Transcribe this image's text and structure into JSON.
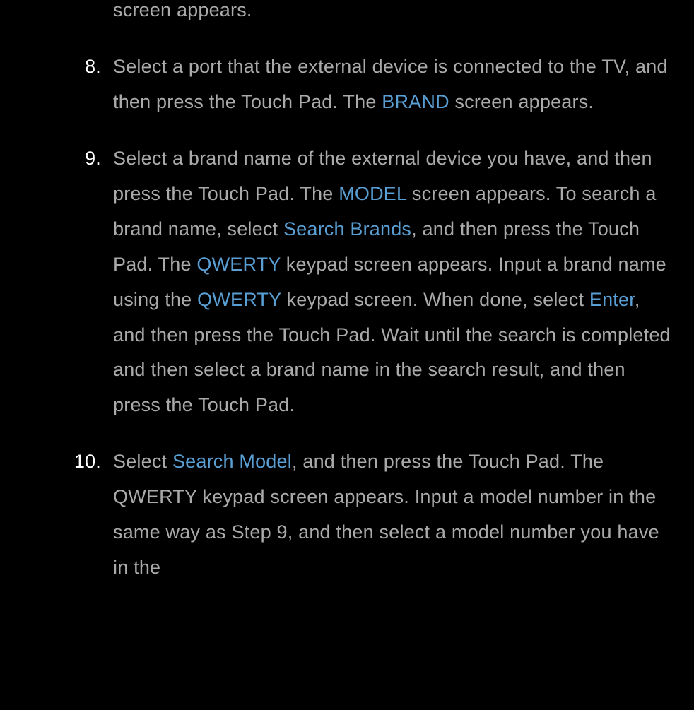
{
  "fragment_top": "screen appears.",
  "items": [
    {
      "number": "8.",
      "parts": [
        {
          "t": "Select a port that the external device is connected to the TV, and then press the Touch Pad. The ",
          "h": false
        },
        {
          "t": "BRAND",
          "h": true
        },
        {
          "t": " screen appears.",
          "h": false
        }
      ]
    },
    {
      "number": "9.",
      "parts": [
        {
          "t": "Select a brand name of the external device you have, and then press the Touch Pad. The ",
          "h": false
        },
        {
          "t": "MODEL",
          "h": true
        },
        {
          "t": " screen appears. To search a brand name, select ",
          "h": false
        },
        {
          "t": "Search Brands",
          "h": true
        },
        {
          "t": ", and then press the Touch Pad. The ",
          "h": false
        },
        {
          "t": "QWERTY",
          "h": true
        },
        {
          "t": " keypad screen appears. Input a brand name using the ",
          "h": false
        },
        {
          "t": "QWERTY",
          "h": true
        },
        {
          "t": " keypad screen. When done, select ",
          "h": false
        },
        {
          "t": "Enter",
          "h": true
        },
        {
          "t": ", and then press the Touch Pad. Wait until the search is completed and then select a brand name in the search result, and then press the Touch Pad.",
          "h": false
        }
      ]
    },
    {
      "number": "10.",
      "parts": [
        {
          "t": "Select ",
          "h": false
        },
        {
          "t": "Search Model",
          "h": true
        },
        {
          "t": ", and then press the Touch Pad. The QWERTY keypad screen appears. Input a model number in the same way as Step 9, and then select a model number you have in the",
          "h": false
        }
      ]
    }
  ]
}
